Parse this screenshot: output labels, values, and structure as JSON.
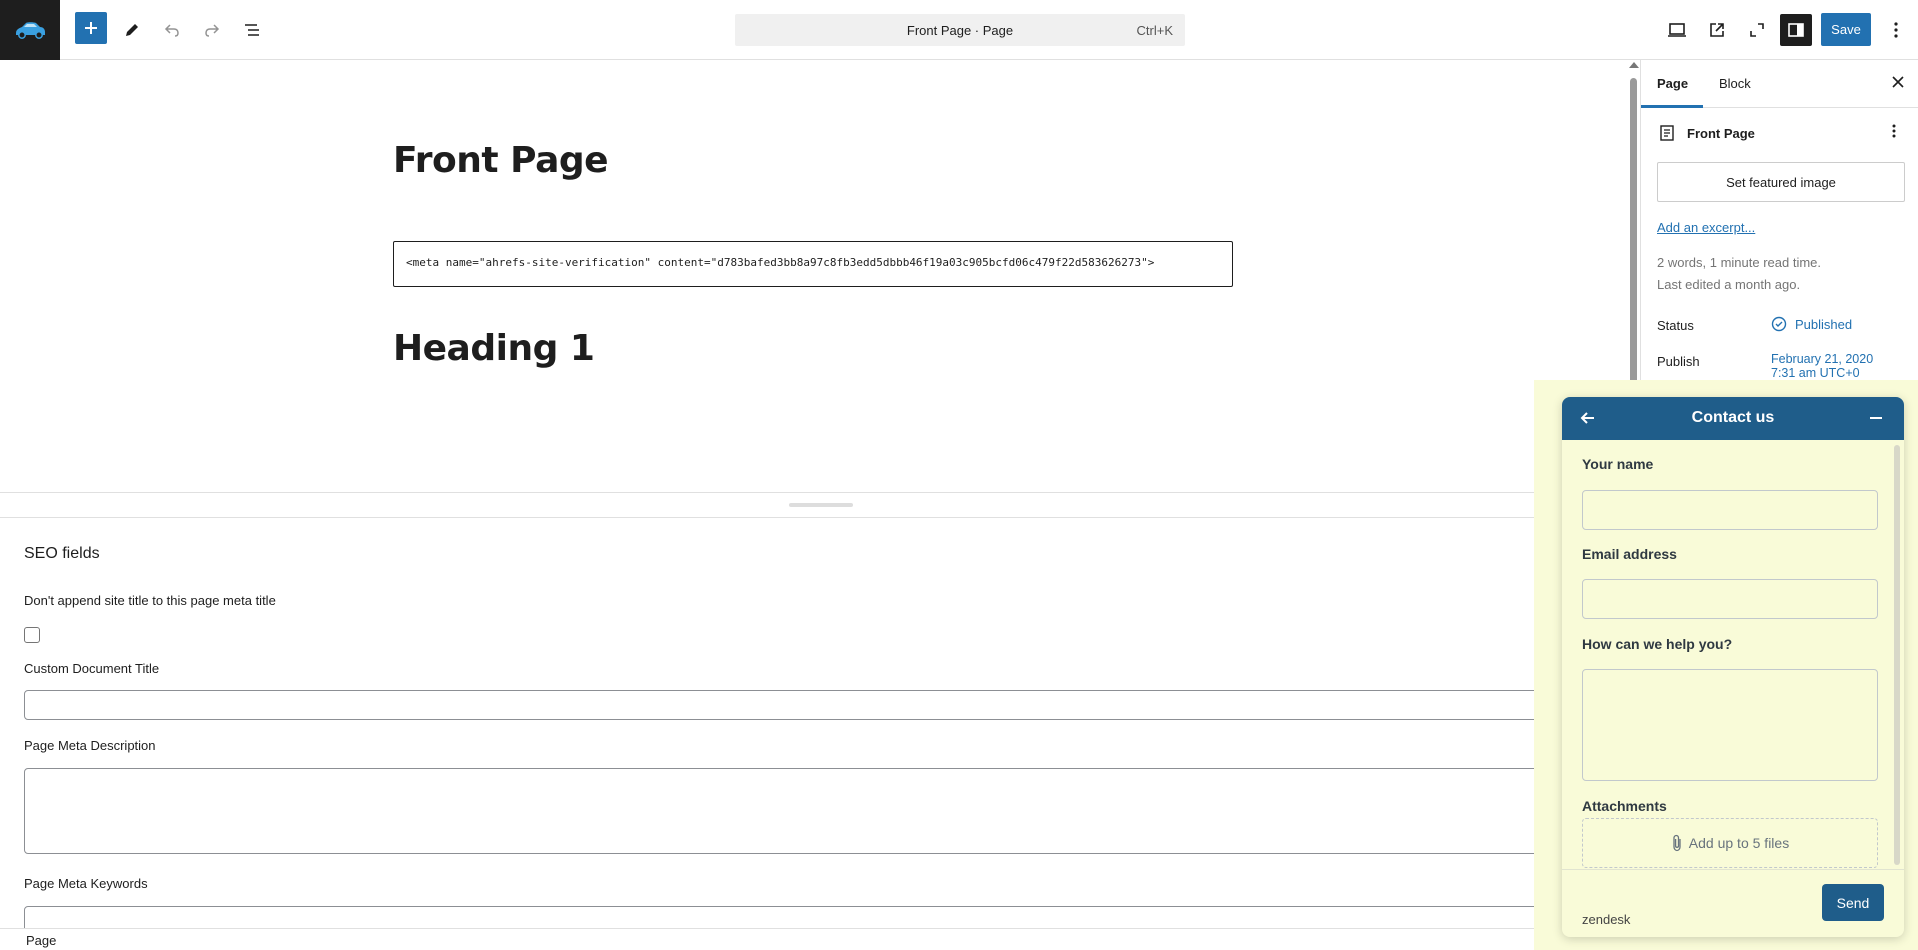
{
  "toolbar": {
    "command_title": "Front Page · Page",
    "command_shortcut": "Ctrl+K",
    "save_label": "Save"
  },
  "editor": {
    "page_title": "Front Page",
    "html_block": "<meta name=\"ahrefs-site-verification\" content=\"d783bafed3bb8a97c8fb3edd5dbbb46f19a03c905bcfd06c479f22d583626273\">",
    "heading": "Heading 1"
  },
  "seo": {
    "title": "SEO fields",
    "append_label": "Don't append site title to this page meta title",
    "doc_title_label": "Custom Document Title",
    "meta_desc_label": "Page Meta Description",
    "meta_keywords_label": "Page Meta Keywords"
  },
  "status_bar": {
    "label": "Page"
  },
  "sidebar": {
    "tabs": [
      {
        "label": "Page"
      },
      {
        "label": "Block"
      }
    ],
    "page_name": "Front Page",
    "featured_image_label": "Set featured image",
    "excerpt_link": "Add an excerpt...",
    "word_count": "2 words, 1 minute read time.",
    "last_edited": "Last edited a month ago.",
    "status_label": "Status",
    "status_value": "Published",
    "publish_label": "Publish",
    "publish_date": "February 21, 2020",
    "publish_time": "7:31 am UTC+0"
  },
  "zendesk": {
    "title": "Contact us",
    "name_label": "Your name",
    "email_label": "Email address",
    "help_label": "How can we help you?",
    "attachments_label": "Attachments",
    "attach_hint": "Add up to 5 files",
    "brand": "zendesk",
    "send_label": "Send"
  },
  "colors": {
    "accent": "#2271b1",
    "zendesk_header": "#1f5d8a",
    "zendesk_bg": "#f9fbd8"
  }
}
